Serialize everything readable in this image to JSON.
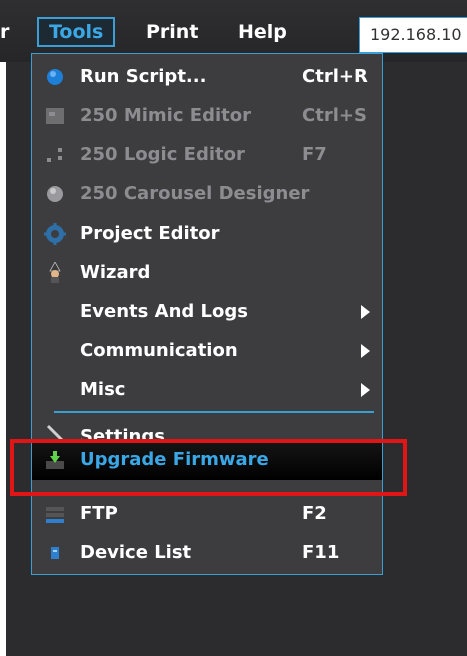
{
  "menubar": {
    "items": [
      {
        "label": "r"
      },
      {
        "label": "Tools"
      },
      {
        "label": "Print"
      },
      {
        "label": "Help"
      }
    ],
    "address": "192.168.10"
  },
  "tools_menu": {
    "items": [
      {
        "label": "Run Script...",
        "shortcut": "Ctrl+R",
        "icon": "blue-circle-icon",
        "enabled": true
      },
      {
        "label": "250 Mimic Editor",
        "shortcut": "Ctrl+S",
        "icon": "mimic-editor-icon",
        "enabled": false
      },
      {
        "label": "250 Logic Editor",
        "shortcut": "F7",
        "icon": "logic-editor-icon",
        "enabled": false
      },
      {
        "label": "250 Carousel Designer",
        "shortcut": "",
        "icon": "carousel-icon",
        "enabled": false
      },
      {
        "label": "Project Editor",
        "shortcut": "",
        "icon": "gear-icon",
        "enabled": true
      },
      {
        "label": "Wizard",
        "shortcut": "",
        "icon": "wizard-icon",
        "enabled": true
      },
      {
        "label": "Events And Logs",
        "submenu": true
      },
      {
        "label": "Communication",
        "submenu": true
      },
      {
        "label": "Misc",
        "submenu": true
      },
      {
        "label": "Settings",
        "icon": "wrench-icon"
      },
      {
        "label": "Upgrade Firmware",
        "icon": "firmware-download-icon",
        "highlighted": true
      },
      {
        "label": "FTP",
        "shortcut": "F2",
        "icon": "ftp-icon"
      },
      {
        "label": "Device List",
        "shortcut": "F11",
        "icon": "device-list-icon"
      }
    ]
  },
  "colors": {
    "accent": "#3a9fd6",
    "highlight_box": "#e01515",
    "menu_bg": "#3d3d40"
  }
}
